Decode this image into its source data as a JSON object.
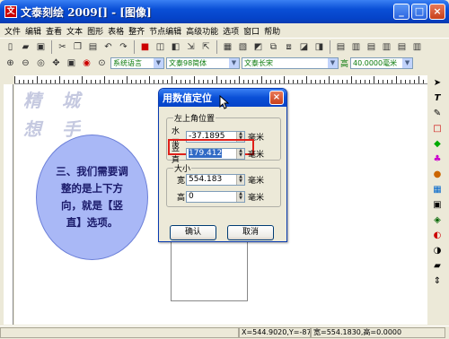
{
  "window": {
    "title": "文泰刻绘 2009[] - [图像]",
    "minimize": "_",
    "maximize": "□",
    "close": "×"
  },
  "menu": [
    "文件",
    "编辑",
    "查看",
    "文本",
    "图形",
    "表格",
    "整齐",
    "节点编辑",
    "高级功能",
    "选项",
    "窗口",
    "帮助"
  ],
  "toolbar2": {
    "font_lang": "系统语言",
    "font_name": "文泰98简体",
    "font_type": "文泰长宋",
    "height_label": "高",
    "height_value": "40.0000毫米"
  },
  "watermark": {
    "line1": "精 城",
    "line2": "想 手"
  },
  "callout": {
    "text": "三、我们需要调整的是上下方向，就是【竖直】选项。"
  },
  "dialog": {
    "title": "用数值定位",
    "close": "×",
    "group_position": "左上角位置",
    "horizontal_label": "水平",
    "horizontal_value": "-37.1895",
    "vertical_label": "竖直",
    "vertical_value": "179.412",
    "unit": "毫米",
    "group_size": "大小",
    "width_label": "宽",
    "width_value": "554.183",
    "height_label": "高",
    "height_value": "0",
    "ok": "确认",
    "cancel": "取消"
  },
  "status": {
    "coords": "X=544.9020,Y=-87.7",
    "size": "宽=554.1830,高=0.0000"
  },
  "colors": {
    "titlebar": "#0a4fd6",
    "callout_fill": "#a9b8f6",
    "highlight_box": "#e0201a",
    "selection": "#316ac5"
  }
}
